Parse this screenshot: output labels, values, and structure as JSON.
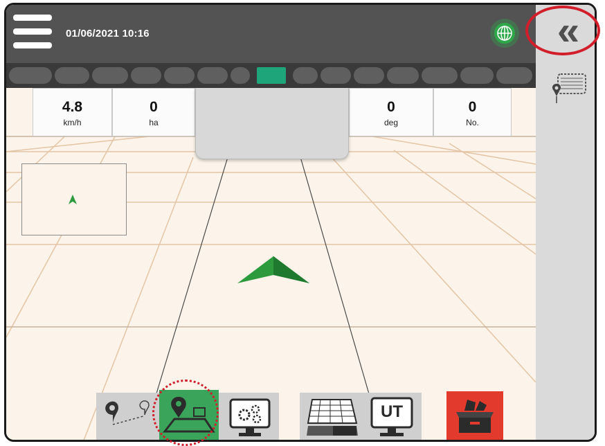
{
  "header": {
    "datetime": "01/06/2021 10:16"
  },
  "stats": [
    {
      "value": "4.8",
      "unit": "km/h"
    },
    {
      "value": "0",
      "unit": "ha"
    },
    {
      "value": "0",
      "unit": "deg"
    },
    {
      "value": "0",
      "unit": "No."
    }
  ],
  "toolbar": {
    "ut_label": "UT"
  },
  "colors": {
    "topbar": "#535353",
    "lightbar_active": "#1fa57a",
    "field_background": "#fcf4ea",
    "side_panel": "#dadada",
    "guidance_green": "#2e9a3e",
    "callout_red": "#d21e2a",
    "close_button_red": "#e23a2d"
  },
  "icons": {
    "menu": "hamburger-menu-icon",
    "gps_status": "gps-globe-icon",
    "collapse": "double-chevron-left-icon",
    "field_boundary": "field-boundary-icon",
    "guidance_mode": "guidance-lines-icon",
    "marking": "marking-point-icon",
    "settings": "monitor-settings-icon",
    "applied_map": "coverage-map-icon",
    "universal_terminal": "ut-monitor-icon",
    "close_job": "close-job-icon"
  }
}
